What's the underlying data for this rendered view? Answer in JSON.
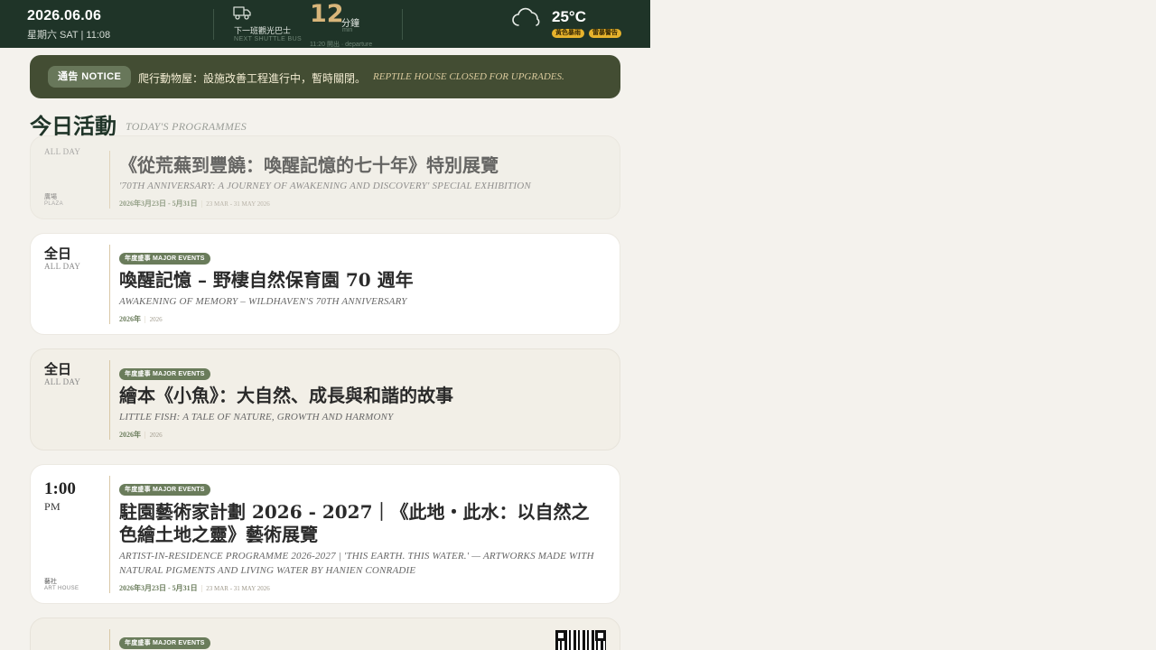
{
  "header": {
    "date": "2026.06.06",
    "weekday": "星期六 SAT | 11:08",
    "bus_label": "下一班觀光巴士",
    "bus_sub": "NEXT SHUTTLE BUS",
    "bus_minutes": "12",
    "bus_unit": "分鐘",
    "bus_unit_en": "min",
    "bus_departure": "11:20 開出 · departure",
    "temperature": "25°C",
    "warnings": [
      "黃色暴雨",
      "雷暴警告"
    ],
    "icons": {
      "bus": "shuttle-bus-icon",
      "weather": "cloud-icon"
    }
  },
  "notice": {
    "badge": "通告 NOTICE",
    "text_zh": "爬行動物屋：設施改善工程進行中，暫時關閉。",
    "text_en": "REPTILE HOUSE CLOSED FOR UPGRADES."
  },
  "section": {
    "title": "今日活動",
    "subtitle": "TODAY'S PROGRAMMES"
  },
  "programmes": [
    {
      "time_en": "ALL DAY",
      "location_zh": "廣場",
      "location_en": "PLAZA",
      "title_zh": "《從荒蕪到豐饒：喚醒記憶的七十年》特別展覽",
      "title_en": "'70TH ANNIVERSARY: A JOURNEY OF AWAKENING AND DISCOVERY' SPECIAL EXHIBITION",
      "dates_zh": "2026年3月23日 - 5月31日",
      "dates_en": "23 MAR - 31 MAY 2026"
    },
    {
      "time_zh": "全日",
      "time_en": "ALL DAY",
      "badge": "年度盛事 MAJOR EVENTS",
      "title_zh": "喚醒記憶 – 野棲自然保育園 70 週年",
      "title_en": "AWAKENING OF MEMORY – WILDHAVEN'S 70TH ANNIVERSARY",
      "dates_zh": "2026年",
      "dates_en": "2026"
    },
    {
      "time_zh": "全日",
      "time_en": "ALL DAY",
      "badge": "年度盛事 MAJOR EVENTS",
      "title_zh": "繪本《小魚》：大自然、成長與和諧的故事",
      "title_en": "LITTLE FISH: A TALE OF NATURE, GROWTH AND HARMONY",
      "dates_zh": "2026年",
      "dates_en": "2026"
    },
    {
      "time_zh": "1:00",
      "time_en": "PM",
      "location_zh": "藝社",
      "location_en": "ART HOUSE",
      "badge": "年度盛事 MAJOR EVENTS",
      "title_zh": "駐園藝術家計劃 2026 - 2027｜《此地・此水：以自然之色繪土地之靈》藝術展覽",
      "title_en": "ARTIST-IN-RESIDENCE PROGRAMME 2026-2027 | 'THIS EARTH. THIS WATER.' — ARTWORKS MADE WITH NATURAL PIGMENTS AND LIVING WATER BY HANIEN CONRADIE",
      "dates_zh": "2026年3月23日 - 5月31日",
      "dates_en": "23 MAR - 31 MAY 2026"
    },
    {
      "badge": "年度盛事 MAJOR EVENTS"
    }
  ],
  "colors": {
    "header_bg": "#1f3428",
    "accent_gold": "#d8b57a",
    "badge_green": "#6a7c5b",
    "warning_yellow": "#e7b32c"
  }
}
